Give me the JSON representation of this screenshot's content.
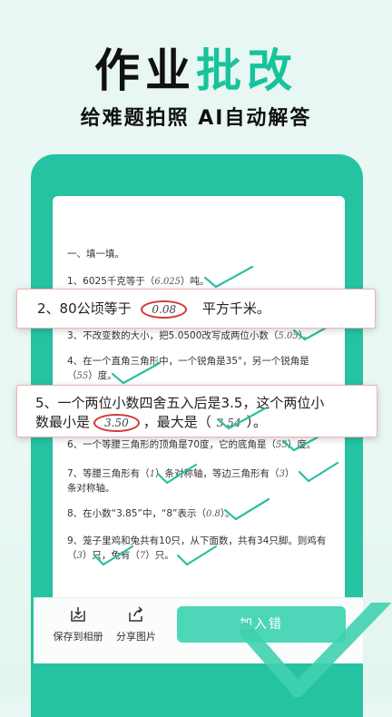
{
  "hero": {
    "title_black": "作业",
    "title_accent": "批改",
    "subtitle": "给难题拍照  AI自动解答"
  },
  "paper": {
    "section_title": "一、填一填。",
    "q1_prefix": "1、6025千克等于（",
    "q1_answer": "6.025",
    "q1_suffix": "）吨。",
    "q3_text": "3、不改变数的大小，把5.0500改写成两位小数（",
    "q3_answer": "5.05",
    "q3_suffix": "）。",
    "q4_line1": "4、在一个直角三角形中，一个锐角是35°，另一个锐角是",
    "q4_prefix": "（",
    "q4_answer": "55",
    "q4_suffix": "）度。",
    "q6_prefix": "6、一个等腰三角形的顶角是70度，它的底角是（",
    "q6_answer": "55",
    "q6_suffix": "）度。",
    "q7_prefix": "7、等腰三角形有（",
    "q7_answer1": "1",
    "q7_mid": "）条对称轴，等边三角形有（",
    "q7_answer2": "3",
    "q7_suffix": "）",
    "q7_line2": "条对称轴。",
    "q8_prefix": "8、在小数“3.85”中，“8”表示（",
    "q8_answer": "0.8",
    "q8_suffix": "）。",
    "q9_line1": "9、笼子里鸡和兔共有10只，从下面数，共有34只脚。则鸡有",
    "q9_prefix": "（",
    "q9_answer1": "3",
    "q9_mid": "）只，兔有（",
    "q9_answer2": "7",
    "q9_suffix": "）只。"
  },
  "callout1": {
    "prefix": "2、80公顷等于",
    "answer": "0.08",
    "suffix": "平方千米。"
  },
  "callout2": {
    "line1": "5、一个两位小数四舍五入后是3.5，这个两位小",
    "line2_prefix": "数最小是",
    "answer1": "3.50",
    "line2_mid": "，最大是（",
    "answer2": "3.54",
    "line2_suffix": "）。"
  },
  "bottom_bar": {
    "save_label": "保存到相册",
    "share_label": "分享图片",
    "join_label": "加入错"
  },
  "colors": {
    "accent": "#17c39b",
    "frame": "#26c3a3",
    "check": "#2bbf9f",
    "circle": "#d23b3b"
  }
}
